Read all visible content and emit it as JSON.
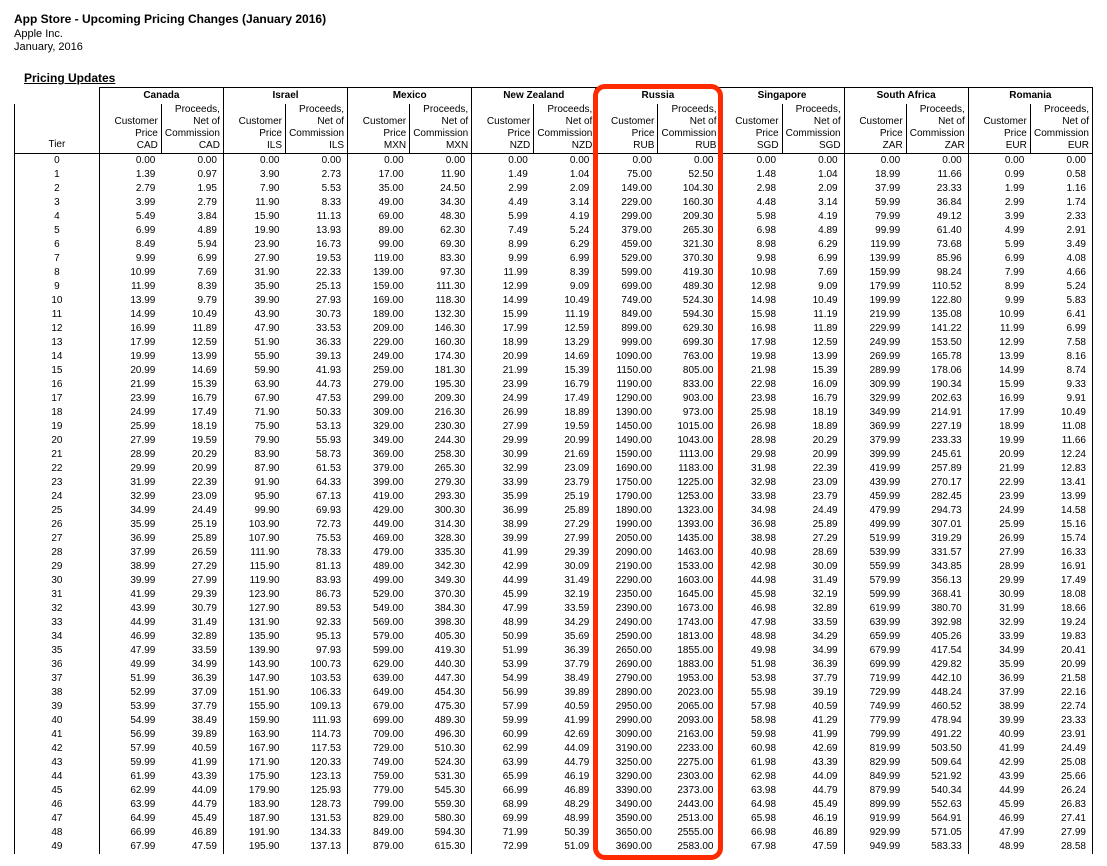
{
  "header": {
    "title": "App Store - Upcoming Pricing Changes (January 2016)",
    "company": "Apple Inc.",
    "date": "January, 2016"
  },
  "section_title": "Pricing Updates",
  "tier_label": "Tier",
  "col_labels": {
    "customer_price": "Customer Price",
    "proceeds": "Proceeds, Net of Commission"
  },
  "regions": [
    {
      "name": "Canada",
      "cur": "CAD"
    },
    {
      "name": "Israel",
      "cur": "ILS"
    },
    {
      "name": "Mexico",
      "cur": "MXN"
    },
    {
      "name": "New Zealand",
      "cur": "NZD"
    },
    {
      "name": "Russia",
      "cur": "RUB"
    },
    {
      "name": "Singapore",
      "cur": "SGD"
    },
    {
      "name": "South Africa",
      "cur": "ZAR"
    },
    {
      "name": "Romania",
      "cur": "EUR"
    }
  ],
  "highlight_region_index": 4,
  "tiers": [
    {
      "t": 0,
      "v": [
        "0.00",
        "0.00",
        "0.00",
        "0.00",
        "0.00",
        "0.00",
        "0.00",
        "0.00",
        "0.00",
        "0.00",
        "0.00",
        "0.00",
        "0.00",
        "0.00",
        "0.00",
        "0.00"
      ]
    },
    {
      "t": 1,
      "v": [
        "1.39",
        "0.97",
        "3.90",
        "2.73",
        "17.00",
        "11.90",
        "1.49",
        "1.04",
        "75.00",
        "52.50",
        "1.48",
        "1.04",
        "18.99",
        "11.66",
        "0.99",
        "0.58"
      ]
    },
    {
      "t": 2,
      "v": [
        "2.79",
        "1.95",
        "7.90",
        "5.53",
        "35.00",
        "24.50",
        "2.99",
        "2.09",
        "149.00",
        "104.30",
        "2.98",
        "2.09",
        "37.99",
        "23.33",
        "1.99",
        "1.16"
      ]
    },
    {
      "t": 3,
      "v": [
        "3.99",
        "2.79",
        "11.90",
        "8.33",
        "49.00",
        "34.30",
        "4.49",
        "3.14",
        "229.00",
        "160.30",
        "4.48",
        "3.14",
        "59.99",
        "36.84",
        "2.99",
        "1.74"
      ]
    },
    {
      "t": 4,
      "v": [
        "5.49",
        "3.84",
        "15.90",
        "11.13",
        "69.00",
        "48.30",
        "5.99",
        "4.19",
        "299.00",
        "209.30",
        "5.98",
        "4.19",
        "79.99",
        "49.12",
        "3.99",
        "2.33"
      ]
    },
    {
      "t": 5,
      "v": [
        "6.99",
        "4.89",
        "19.90",
        "13.93",
        "89.00",
        "62.30",
        "7.49",
        "5.24",
        "379.00",
        "265.30",
        "6.98",
        "4.89",
        "99.99",
        "61.40",
        "4.99",
        "2.91"
      ]
    },
    {
      "t": 6,
      "v": [
        "8.49",
        "5.94",
        "23.90",
        "16.73",
        "99.00",
        "69.30",
        "8.99",
        "6.29",
        "459.00",
        "321.30",
        "8.98",
        "6.29",
        "119.99",
        "73.68",
        "5.99",
        "3.49"
      ]
    },
    {
      "t": 7,
      "v": [
        "9.99",
        "6.99",
        "27.90",
        "19.53",
        "119.00",
        "83.30",
        "9.99",
        "6.99",
        "529.00",
        "370.30",
        "9.98",
        "6.99",
        "139.99",
        "85.96",
        "6.99",
        "4.08"
      ]
    },
    {
      "t": 8,
      "v": [
        "10.99",
        "7.69",
        "31.90",
        "22.33",
        "139.00",
        "97.30",
        "11.99",
        "8.39",
        "599.00",
        "419.30",
        "10.98",
        "7.69",
        "159.99",
        "98.24",
        "7.99",
        "4.66"
      ]
    },
    {
      "t": 9,
      "v": [
        "11.99",
        "8.39",
        "35.90",
        "25.13",
        "159.00",
        "111.30",
        "12.99",
        "9.09",
        "699.00",
        "489.30",
        "12.98",
        "9.09",
        "179.99",
        "110.52",
        "8.99",
        "5.24"
      ]
    },
    {
      "t": 10,
      "v": [
        "13.99",
        "9.79",
        "39.90",
        "27.93",
        "169.00",
        "118.30",
        "14.99",
        "10.49",
        "749.00",
        "524.30",
        "14.98",
        "10.49",
        "199.99",
        "122.80",
        "9.99",
        "5.83"
      ]
    },
    {
      "t": 11,
      "v": [
        "14.99",
        "10.49",
        "43.90",
        "30.73",
        "189.00",
        "132.30",
        "15.99",
        "11.19",
        "849.00",
        "594.30",
        "15.98",
        "11.19",
        "219.99",
        "135.08",
        "10.99",
        "6.41"
      ]
    },
    {
      "t": 12,
      "v": [
        "16.99",
        "11.89",
        "47.90",
        "33.53",
        "209.00",
        "146.30",
        "17.99",
        "12.59",
        "899.00",
        "629.30",
        "16.98",
        "11.89",
        "229.99",
        "141.22",
        "11.99",
        "6.99"
      ]
    },
    {
      "t": 13,
      "v": [
        "17.99",
        "12.59",
        "51.90",
        "36.33",
        "229.00",
        "160.30",
        "18.99",
        "13.29",
        "999.00",
        "699.30",
        "17.98",
        "12.59",
        "249.99",
        "153.50",
        "12.99",
        "7.58"
      ]
    },
    {
      "t": 14,
      "v": [
        "19.99",
        "13.99",
        "55.90",
        "39.13",
        "249.00",
        "174.30",
        "20.99",
        "14.69",
        "1090.00",
        "763.00",
        "19.98",
        "13.99",
        "269.99",
        "165.78",
        "13.99",
        "8.16"
      ]
    },
    {
      "t": 15,
      "v": [
        "20.99",
        "14.69",
        "59.90",
        "41.93",
        "259.00",
        "181.30",
        "21.99",
        "15.39",
        "1150.00",
        "805.00",
        "21.98",
        "15.39",
        "289.99",
        "178.06",
        "14.99",
        "8.74"
      ]
    },
    {
      "t": 16,
      "v": [
        "21.99",
        "15.39",
        "63.90",
        "44.73",
        "279.00",
        "195.30",
        "23.99",
        "16.79",
        "1190.00",
        "833.00",
        "22.98",
        "16.09",
        "309.99",
        "190.34",
        "15.99",
        "9.33"
      ]
    },
    {
      "t": 17,
      "v": [
        "23.99",
        "16.79",
        "67.90",
        "47.53",
        "299.00",
        "209.30",
        "24.99",
        "17.49",
        "1290.00",
        "903.00",
        "23.98",
        "16.79",
        "329.99",
        "202.63",
        "16.99",
        "9.91"
      ]
    },
    {
      "t": 18,
      "v": [
        "24.99",
        "17.49",
        "71.90",
        "50.33",
        "309.00",
        "216.30",
        "26.99",
        "18.89",
        "1390.00",
        "973.00",
        "25.98",
        "18.19",
        "349.99",
        "214.91",
        "17.99",
        "10.49"
      ]
    },
    {
      "t": 19,
      "v": [
        "25.99",
        "18.19",
        "75.90",
        "53.13",
        "329.00",
        "230.30",
        "27.99",
        "19.59",
        "1450.00",
        "1015.00",
        "26.98",
        "18.89",
        "369.99",
        "227.19",
        "18.99",
        "11.08"
      ]
    },
    {
      "t": 20,
      "v": [
        "27.99",
        "19.59",
        "79.90",
        "55.93",
        "349.00",
        "244.30",
        "29.99",
        "20.99",
        "1490.00",
        "1043.00",
        "28.98",
        "20.29",
        "379.99",
        "233.33",
        "19.99",
        "11.66"
      ]
    },
    {
      "t": 21,
      "v": [
        "28.99",
        "20.29",
        "83.90",
        "58.73",
        "369.00",
        "258.30",
        "30.99",
        "21.69",
        "1590.00",
        "1113.00",
        "29.98",
        "20.99",
        "399.99",
        "245.61",
        "20.99",
        "12.24"
      ]
    },
    {
      "t": 22,
      "v": [
        "29.99",
        "20.99",
        "87.90",
        "61.53",
        "379.00",
        "265.30",
        "32.99",
        "23.09",
        "1690.00",
        "1183.00",
        "31.98",
        "22.39",
        "419.99",
        "257.89",
        "21.99",
        "12.83"
      ]
    },
    {
      "t": 23,
      "v": [
        "31.99",
        "22.39",
        "91.90",
        "64.33",
        "399.00",
        "279.30",
        "33.99",
        "23.79",
        "1750.00",
        "1225.00",
        "32.98",
        "23.09",
        "439.99",
        "270.17",
        "22.99",
        "13.41"
      ]
    },
    {
      "t": 24,
      "v": [
        "32.99",
        "23.09",
        "95.90",
        "67.13",
        "419.00",
        "293.30",
        "35.99",
        "25.19",
        "1790.00",
        "1253.00",
        "33.98",
        "23.79",
        "459.99",
        "282.45",
        "23.99",
        "13.99"
      ]
    },
    {
      "t": 25,
      "v": [
        "34.99",
        "24.49",
        "99.90",
        "69.93",
        "429.00",
        "300.30",
        "36.99",
        "25.89",
        "1890.00",
        "1323.00",
        "34.98",
        "24.49",
        "479.99",
        "294.73",
        "24.99",
        "14.58"
      ]
    },
    {
      "t": 26,
      "v": [
        "35.99",
        "25.19",
        "103.90",
        "72.73",
        "449.00",
        "314.30",
        "38.99",
        "27.29",
        "1990.00",
        "1393.00",
        "36.98",
        "25.89",
        "499.99",
        "307.01",
        "25.99",
        "15.16"
      ]
    },
    {
      "t": 27,
      "v": [
        "36.99",
        "25.89",
        "107.90",
        "75.53",
        "469.00",
        "328.30",
        "39.99",
        "27.99",
        "2050.00",
        "1435.00",
        "38.98",
        "27.29",
        "519.99",
        "319.29",
        "26.99",
        "15.74"
      ]
    },
    {
      "t": 28,
      "v": [
        "37.99",
        "26.59",
        "111.90",
        "78.33",
        "479.00",
        "335.30",
        "41.99",
        "29.39",
        "2090.00",
        "1463.00",
        "40.98",
        "28.69",
        "539.99",
        "331.57",
        "27.99",
        "16.33"
      ]
    },
    {
      "t": 29,
      "v": [
        "38.99",
        "27.29",
        "115.90",
        "81.13",
        "489.00",
        "342.30",
        "42.99",
        "30.09",
        "2190.00",
        "1533.00",
        "42.98",
        "30.09",
        "559.99",
        "343.85",
        "28.99",
        "16.91"
      ]
    },
    {
      "t": 30,
      "v": [
        "39.99",
        "27.99",
        "119.90",
        "83.93",
        "499.00",
        "349.30",
        "44.99",
        "31.49",
        "2290.00",
        "1603.00",
        "44.98",
        "31.49",
        "579.99",
        "356.13",
        "29.99",
        "17.49"
      ]
    },
    {
      "t": 31,
      "v": [
        "41.99",
        "29.39",
        "123.90",
        "86.73",
        "529.00",
        "370.30",
        "45.99",
        "32.19",
        "2350.00",
        "1645.00",
        "45.98",
        "32.19",
        "599.99",
        "368.41",
        "30.99",
        "18.08"
      ]
    },
    {
      "t": 32,
      "v": [
        "43.99",
        "30.79",
        "127.90",
        "89.53",
        "549.00",
        "384.30",
        "47.99",
        "33.59",
        "2390.00",
        "1673.00",
        "46.98",
        "32.89",
        "619.99",
        "380.70",
        "31.99",
        "18.66"
      ]
    },
    {
      "t": 33,
      "v": [
        "44.99",
        "31.49",
        "131.90",
        "92.33",
        "569.00",
        "398.30",
        "48.99",
        "34.29",
        "2490.00",
        "1743.00",
        "47.98",
        "33.59",
        "639.99",
        "392.98",
        "32.99",
        "19.24"
      ]
    },
    {
      "t": 34,
      "v": [
        "46.99",
        "32.89",
        "135.90",
        "95.13",
        "579.00",
        "405.30",
        "50.99",
        "35.69",
        "2590.00",
        "1813.00",
        "48.98",
        "34.29",
        "659.99",
        "405.26",
        "33.99",
        "19.83"
      ]
    },
    {
      "t": 35,
      "v": [
        "47.99",
        "33.59",
        "139.90",
        "97.93",
        "599.00",
        "419.30",
        "51.99",
        "36.39",
        "2650.00",
        "1855.00",
        "49.98",
        "34.99",
        "679.99",
        "417.54",
        "34.99",
        "20.41"
      ]
    },
    {
      "t": 36,
      "v": [
        "49.99",
        "34.99",
        "143.90",
        "100.73",
        "629.00",
        "440.30",
        "53.99",
        "37.79",
        "2690.00",
        "1883.00",
        "51.98",
        "36.39",
        "699.99",
        "429.82",
        "35.99",
        "20.99"
      ]
    },
    {
      "t": 37,
      "v": [
        "51.99",
        "36.39",
        "147.90",
        "103.53",
        "639.00",
        "447.30",
        "54.99",
        "38.49",
        "2790.00",
        "1953.00",
        "53.98",
        "37.79",
        "719.99",
        "442.10",
        "36.99",
        "21.58"
      ]
    },
    {
      "t": 38,
      "v": [
        "52.99",
        "37.09",
        "151.90",
        "106.33",
        "649.00",
        "454.30",
        "56.99",
        "39.89",
        "2890.00",
        "2023.00",
        "55.98",
        "39.19",
        "729.99",
        "448.24",
        "37.99",
        "22.16"
      ]
    },
    {
      "t": 39,
      "v": [
        "53.99",
        "37.79",
        "155.90",
        "109.13",
        "679.00",
        "475.30",
        "57.99",
        "40.59",
        "2950.00",
        "2065.00",
        "57.98",
        "40.59",
        "749.99",
        "460.52",
        "38.99",
        "22.74"
      ]
    },
    {
      "t": 40,
      "v": [
        "54.99",
        "38.49",
        "159.90",
        "111.93",
        "699.00",
        "489.30",
        "59.99",
        "41.99",
        "2990.00",
        "2093.00",
        "58.98",
        "41.29",
        "779.99",
        "478.94",
        "39.99",
        "23.33"
      ]
    },
    {
      "t": 41,
      "v": [
        "56.99",
        "39.89",
        "163.90",
        "114.73",
        "709.00",
        "496.30",
        "60.99",
        "42.69",
        "3090.00",
        "2163.00",
        "59.98",
        "41.99",
        "799.99",
        "491.22",
        "40.99",
        "23.91"
      ]
    },
    {
      "t": 42,
      "v": [
        "57.99",
        "40.59",
        "167.90",
        "117.53",
        "729.00",
        "510.30",
        "62.99",
        "44.09",
        "3190.00",
        "2233.00",
        "60.98",
        "42.69",
        "819.99",
        "503.50",
        "41.99",
        "24.49"
      ]
    },
    {
      "t": 43,
      "v": [
        "59.99",
        "41.99",
        "171.90",
        "120.33",
        "749.00",
        "524.30",
        "63.99",
        "44.79",
        "3250.00",
        "2275.00",
        "61.98",
        "43.39",
        "829.99",
        "509.64",
        "42.99",
        "25.08"
      ]
    },
    {
      "t": 44,
      "v": [
        "61.99",
        "43.39",
        "175.90",
        "123.13",
        "759.00",
        "531.30",
        "65.99",
        "46.19",
        "3290.00",
        "2303.00",
        "62.98",
        "44.09",
        "849.99",
        "521.92",
        "43.99",
        "25.66"
      ]
    },
    {
      "t": 45,
      "v": [
        "62.99",
        "44.09",
        "179.90",
        "125.93",
        "779.00",
        "545.30",
        "66.99",
        "46.89",
        "3390.00",
        "2373.00",
        "63.98",
        "44.79",
        "879.99",
        "540.34",
        "44.99",
        "26.24"
      ]
    },
    {
      "t": 46,
      "v": [
        "63.99",
        "44.79",
        "183.90",
        "128.73",
        "799.00",
        "559.30",
        "68.99",
        "48.29",
        "3490.00",
        "2443.00",
        "64.98",
        "45.49",
        "899.99",
        "552.63",
        "45.99",
        "26.83"
      ]
    },
    {
      "t": 47,
      "v": [
        "64.99",
        "45.49",
        "187.90",
        "131.53",
        "829.00",
        "580.30",
        "69.99",
        "48.99",
        "3590.00",
        "2513.00",
        "65.98",
        "46.19",
        "919.99",
        "564.91",
        "46.99",
        "27.41"
      ]
    },
    {
      "t": 48,
      "v": [
        "66.99",
        "46.89",
        "191.90",
        "134.33",
        "849.00",
        "594.30",
        "71.99",
        "50.39",
        "3650.00",
        "2555.00",
        "66.98",
        "46.89",
        "929.99",
        "571.05",
        "47.99",
        "27.99"
      ]
    },
    {
      "t": 49,
      "v": [
        "67.99",
        "47.59",
        "195.90",
        "137.13",
        "879.00",
        "615.30",
        "72.99",
        "51.09",
        "3690.00",
        "2583.00",
        "67.98",
        "47.59",
        "949.99",
        "583.33",
        "48.99",
        "28.58"
      ]
    }
  ]
}
